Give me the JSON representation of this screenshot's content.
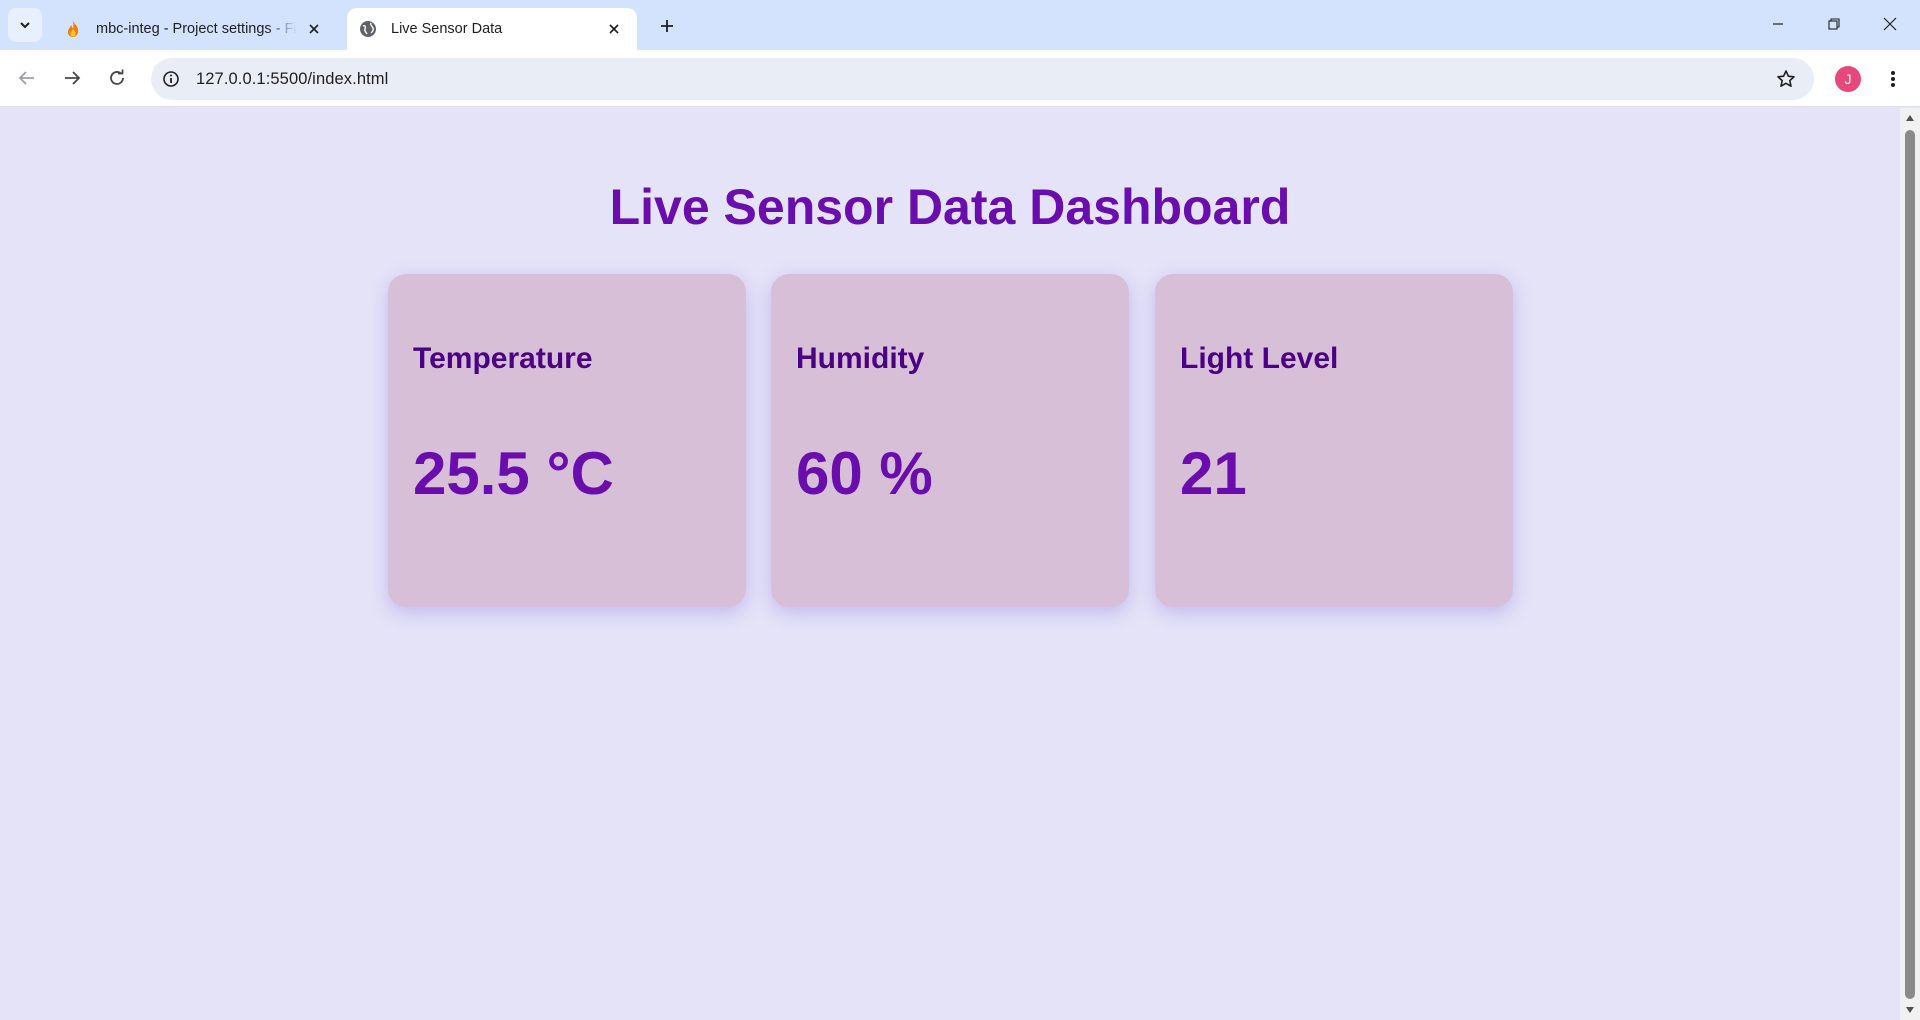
{
  "browser": {
    "tabs": [
      {
        "title": "mbc-integ - Project settings - Firebase console",
        "active": false,
        "favicon": "firebase-icon"
      },
      {
        "title": "Live Sensor Data",
        "active": true,
        "favicon": "globe-icon"
      }
    ],
    "address_bar": {
      "url": "127.0.0.1:5500/index.html"
    },
    "profile_initial": "J",
    "colors": {
      "tabstrip": "#d3e3fd",
      "avatar": "#e8477a"
    }
  },
  "page": {
    "title": "Live Sensor Data Dashboard",
    "cards": [
      {
        "label": "Temperature",
        "value": "25.5 °C"
      },
      {
        "label": "Humidity",
        "value": "60 %"
      },
      {
        "label": "Light Level",
        "value": "21"
      }
    ],
    "colors": {
      "background": "#e4e3f7",
      "card": "#d8bfd8",
      "heading": "#6a0dad",
      "label": "#4b0082"
    }
  }
}
